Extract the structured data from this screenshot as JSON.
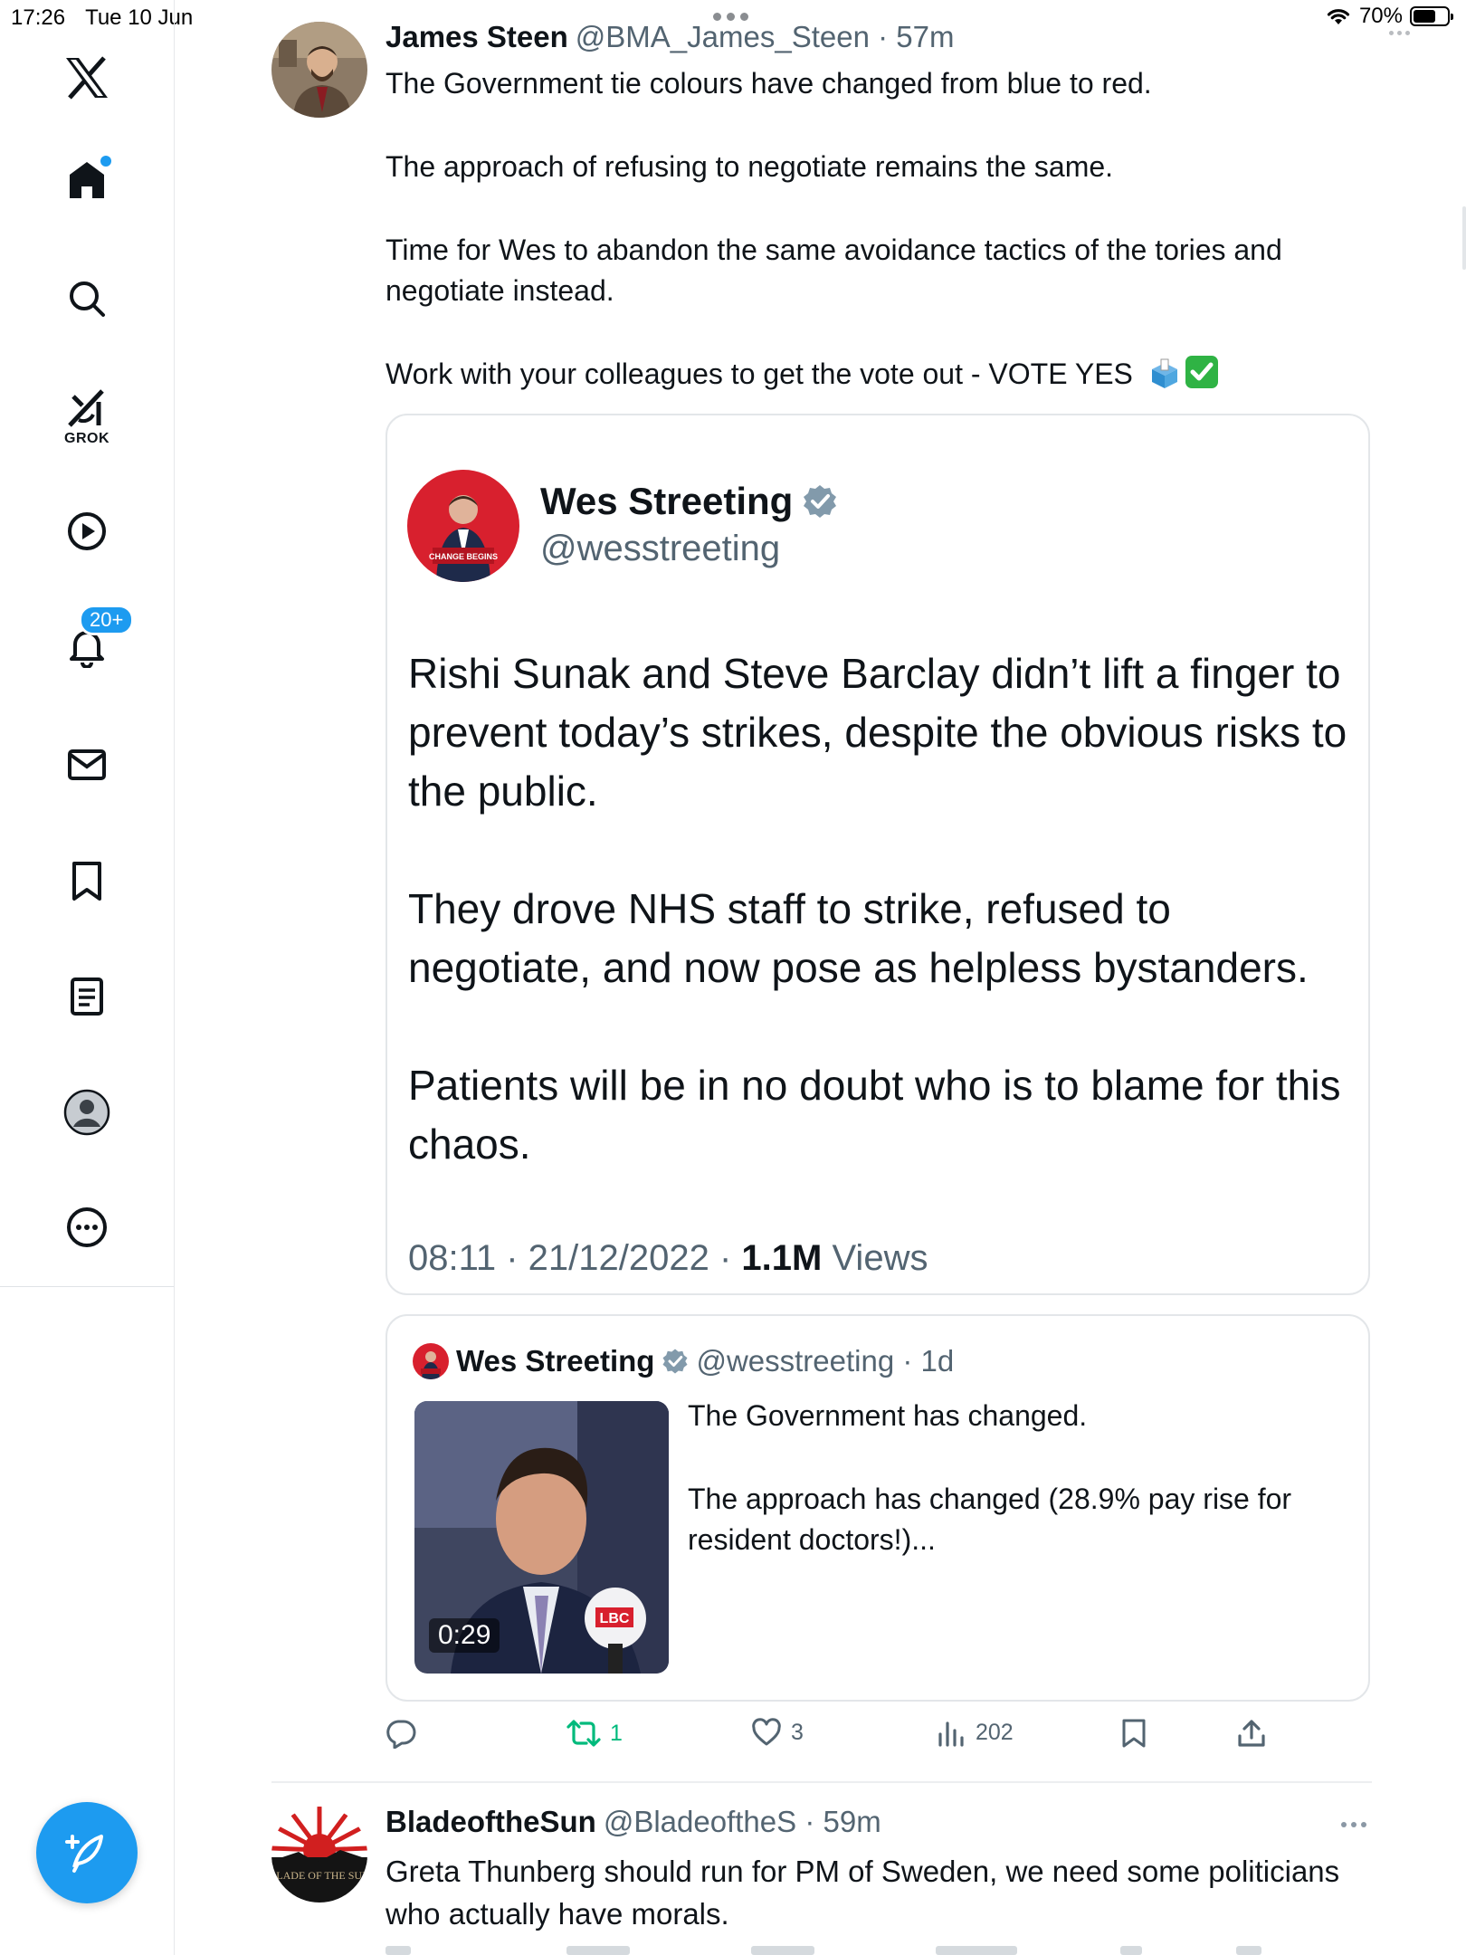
{
  "status_bar": {
    "time": "17:26",
    "date": "Tue 10 Jun",
    "battery": "70%",
    "battery_level": 0.7
  },
  "sidebar": {
    "logo": "x-logo-icon",
    "items": [
      {
        "name": "home",
        "icon": "home-icon",
        "unread_dot": true
      },
      {
        "name": "explore",
        "icon": "search-icon"
      },
      {
        "name": "grok",
        "icon": "grok-icon",
        "label": "GROK"
      },
      {
        "name": "videos",
        "icon": "play-icon"
      },
      {
        "name": "notifications",
        "icon": "bell-icon",
        "badge": "20+"
      },
      {
        "name": "messages",
        "icon": "mail-icon"
      },
      {
        "name": "bookmarks",
        "icon": "bookmark-icon"
      },
      {
        "name": "lists",
        "icon": "list-icon"
      },
      {
        "name": "profile",
        "icon": "profile-icon"
      },
      {
        "name": "more",
        "icon": "more-icon"
      }
    ],
    "compose_icon": "compose-icon"
  },
  "post": {
    "author_name": "James Steen",
    "author_handle": "@BMA_James_Steen",
    "time": "57m",
    "paragraphs": [
      "The Government tie colours have changed from blue to red.",
      "The approach of refusing to negotiate remains the same.",
      "Time for Wes to abandon the same avoidance tactics of the tories and negotiate instead.",
      "Work with your colleagues to get the vote out - VOTE YES"
    ],
    "emojis": [
      "ballot-box-icon",
      "check-mark-icon"
    ],
    "screenshot_card": {
      "author_name": "Wes Streeting",
      "author_handle": "@wesstreeting",
      "paragraphs": [
        "Rishi Sunak and Steve Barclay didn’t lift a finger to prevent today’s strikes, despite the obvious risks to the public.",
        "They drove NHS staff to strike, refused to negotiate, and now pose as helpless bystanders.",
        "Patients will be in no doubt who is to blame for this chaos."
      ],
      "timestamp": "08:11 · 21/12/2022 · ",
      "views_count": "1.1M",
      "views_label": " Views"
    },
    "quoted": {
      "author_name": "Wes Streeting",
      "author_handle": "@wesstreeting",
      "time": "1d",
      "video_duration": "0:29",
      "mic_label": "LBC",
      "paragraphs": [
        "The Government has changed.",
        "The approach has changed (28.9% pay rise for resident doctors!)..."
      ]
    },
    "actions": {
      "reply": "",
      "reposts": "1",
      "likes": "3",
      "views": "202"
    }
  },
  "post2": {
    "author_name": "BladeoftheSun",
    "author_handle": "@BladeoftheS",
    "time": "59m",
    "text": "Greta Thunberg should run for PM of Sweden, we need some politicians who actually have morals.",
    "avatar_text": "BLADE OF THE SUN"
  },
  "colors": {
    "accent": "#1d9bf0",
    "text": "#0f1419",
    "muted": "#536471",
    "repost": "#00ba7c"
  }
}
